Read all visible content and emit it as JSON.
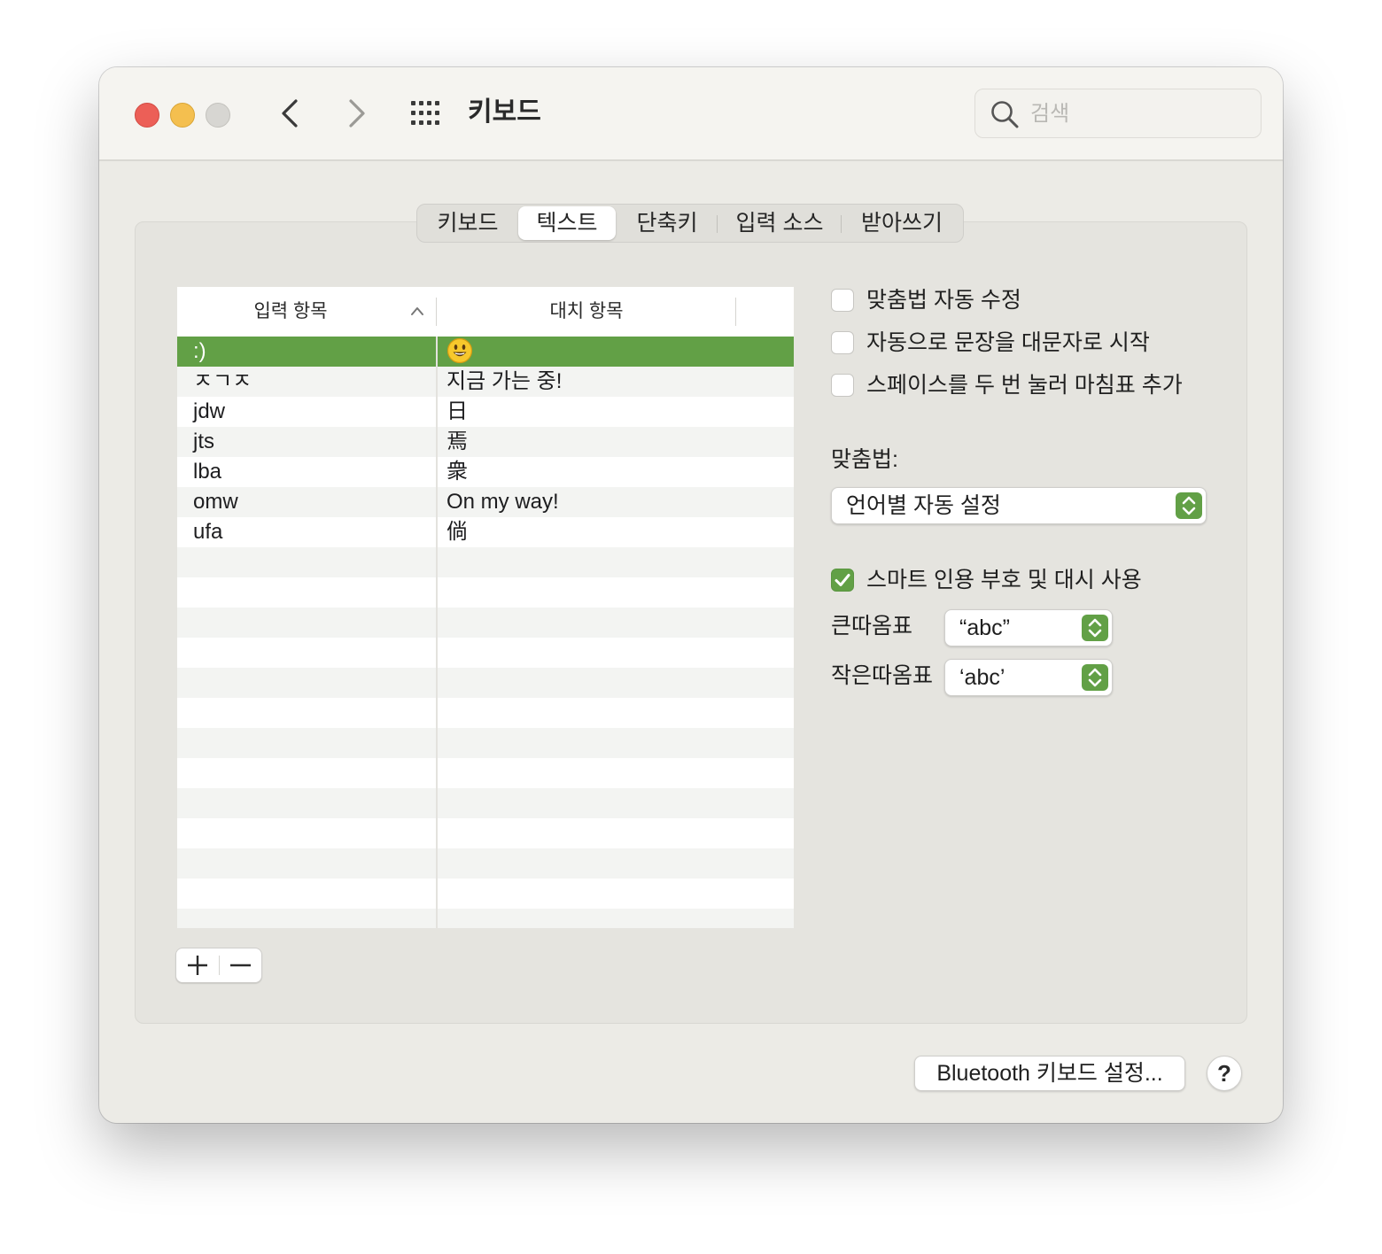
{
  "window": {
    "title": "키보드"
  },
  "search": {
    "placeholder": "검색",
    "value": ""
  },
  "tabs": [
    {
      "label": "키보드",
      "active": false
    },
    {
      "label": "텍스트",
      "active": true
    },
    {
      "label": "단축키",
      "active": false
    },
    {
      "label": "입력 소스",
      "active": false
    },
    {
      "label": "받아쓰기",
      "active": false
    }
  ],
  "table": {
    "columns": [
      "입력 항목",
      "대치 항목"
    ],
    "rows": [
      {
        "replace": ":)",
        "with": "",
        "with_icon": "smiley-emoji-icon",
        "selected": true
      },
      {
        "replace": "ㅈㄱㅈ",
        "with": "지금 가는 중!"
      },
      {
        "replace": "jdw",
        "with": "日"
      },
      {
        "replace": "jts",
        "with": "焉"
      },
      {
        "replace": "lba",
        "with": "衆"
      },
      {
        "replace": "omw",
        "with": "On my way!"
      },
      {
        "replace": "ufa",
        "with": "倘"
      }
    ],
    "add_label": "+",
    "remove_label": "—"
  },
  "options": {
    "auto_correct": {
      "label": "맞춤법 자동 수정",
      "checked": false
    },
    "auto_capitalize": {
      "label": "자동으로 문장을 대문자로 시작",
      "checked": false
    },
    "double_space_period": {
      "label": "스페이스를 두 번 눌러 마침표 추가",
      "checked": false
    },
    "spelling_label": "맞춤법:",
    "spelling_value": "언어별 자동 설정",
    "smart_quotes": {
      "label": "스마트 인용 부호 및 대시 사용",
      "checked": true
    },
    "double_quotes_label": "큰따옴표",
    "double_quotes_value": "“abc”",
    "single_quotes_label": "작은따옴표",
    "single_quotes_value": "‘abc’"
  },
  "footer": {
    "bluetooth_label": "Bluetooth 키보드 설정...",
    "help_label": "?"
  },
  "colors": {
    "accent": "#62a046",
    "close": "#ec5f57",
    "minimize": "#f4bf4f",
    "zoom_disabled": "#d7d6d2"
  }
}
